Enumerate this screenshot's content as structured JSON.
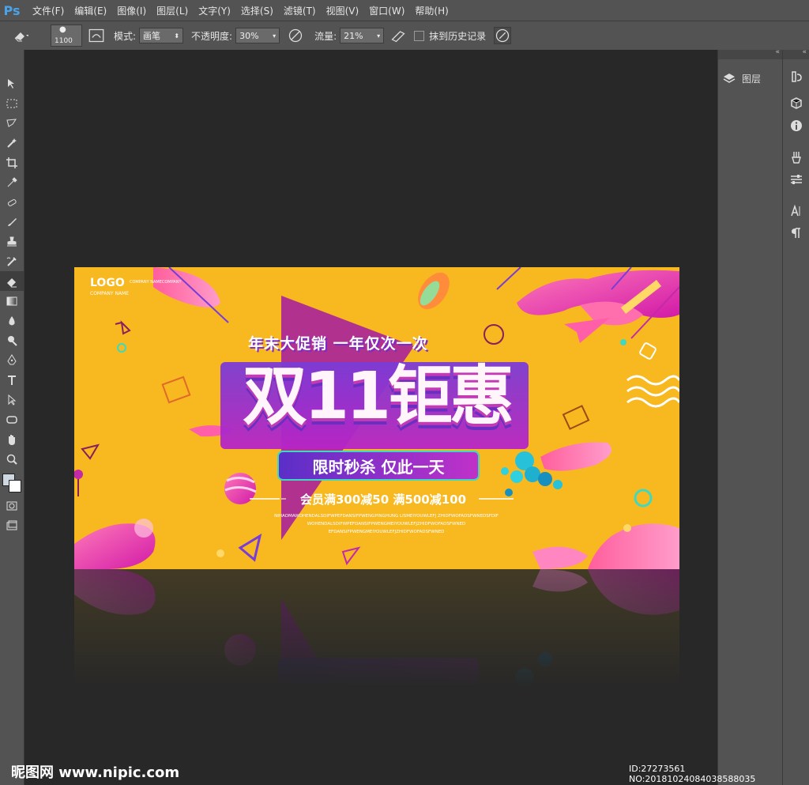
{
  "app": {
    "logo": "Ps"
  },
  "menu": [
    "文件(F)",
    "编辑(E)",
    "图像(I)",
    "图层(L)",
    "文字(Y)",
    "选择(S)",
    "滤镜(T)",
    "视图(V)",
    "窗口(W)",
    "帮助(H)"
  ],
  "options": {
    "brush_size": "1100",
    "mode_label": "模式:",
    "mode_value": "画笔",
    "opacity_label": "不透明度:",
    "opacity_value": "30%",
    "flow_label": "流量:",
    "flow_value": "21%",
    "history_label": "抹到历史记录"
  },
  "panels": {
    "layers_label": "图层"
  },
  "banner": {
    "logo": "LOGO",
    "company_tagline": "COMPANY NAMECOMPANY",
    "company_name": "COMPANY NAME",
    "promo_line": "年末大促销 一年仅次一次",
    "headline": "双11钜惠",
    "flash_sale": "限时秒杀 仅此一天",
    "member_offer": "会员满300减50 满500减100",
    "filler_lines": [
      "NIHAOMAWOHENDALSDIFWPEFDANSIFPWENGPINGHUNG LISMEIYOUWLEFJ ZHIDFWOFADSFWNEDSFDIF",
      "WOHENDALSDIFWPEFDANSIFPWENGMEIYOUWLEFJZHIDFWOFADSFWNED",
      "EFDANSIFPWENGMEIYOUWLEFJZHIDFWOFADSFWNED"
    ]
  },
  "footer": {
    "watermark": "昵图网 www.nipic.com",
    "id_text": "ID:27273561 NO:20181024084038588035"
  },
  "colors": {
    "accent_yellow": "#f8b820",
    "accent_purple": "#8a2be2",
    "accent_pink": "#ff3fa8",
    "ui_gray": "#535353"
  }
}
